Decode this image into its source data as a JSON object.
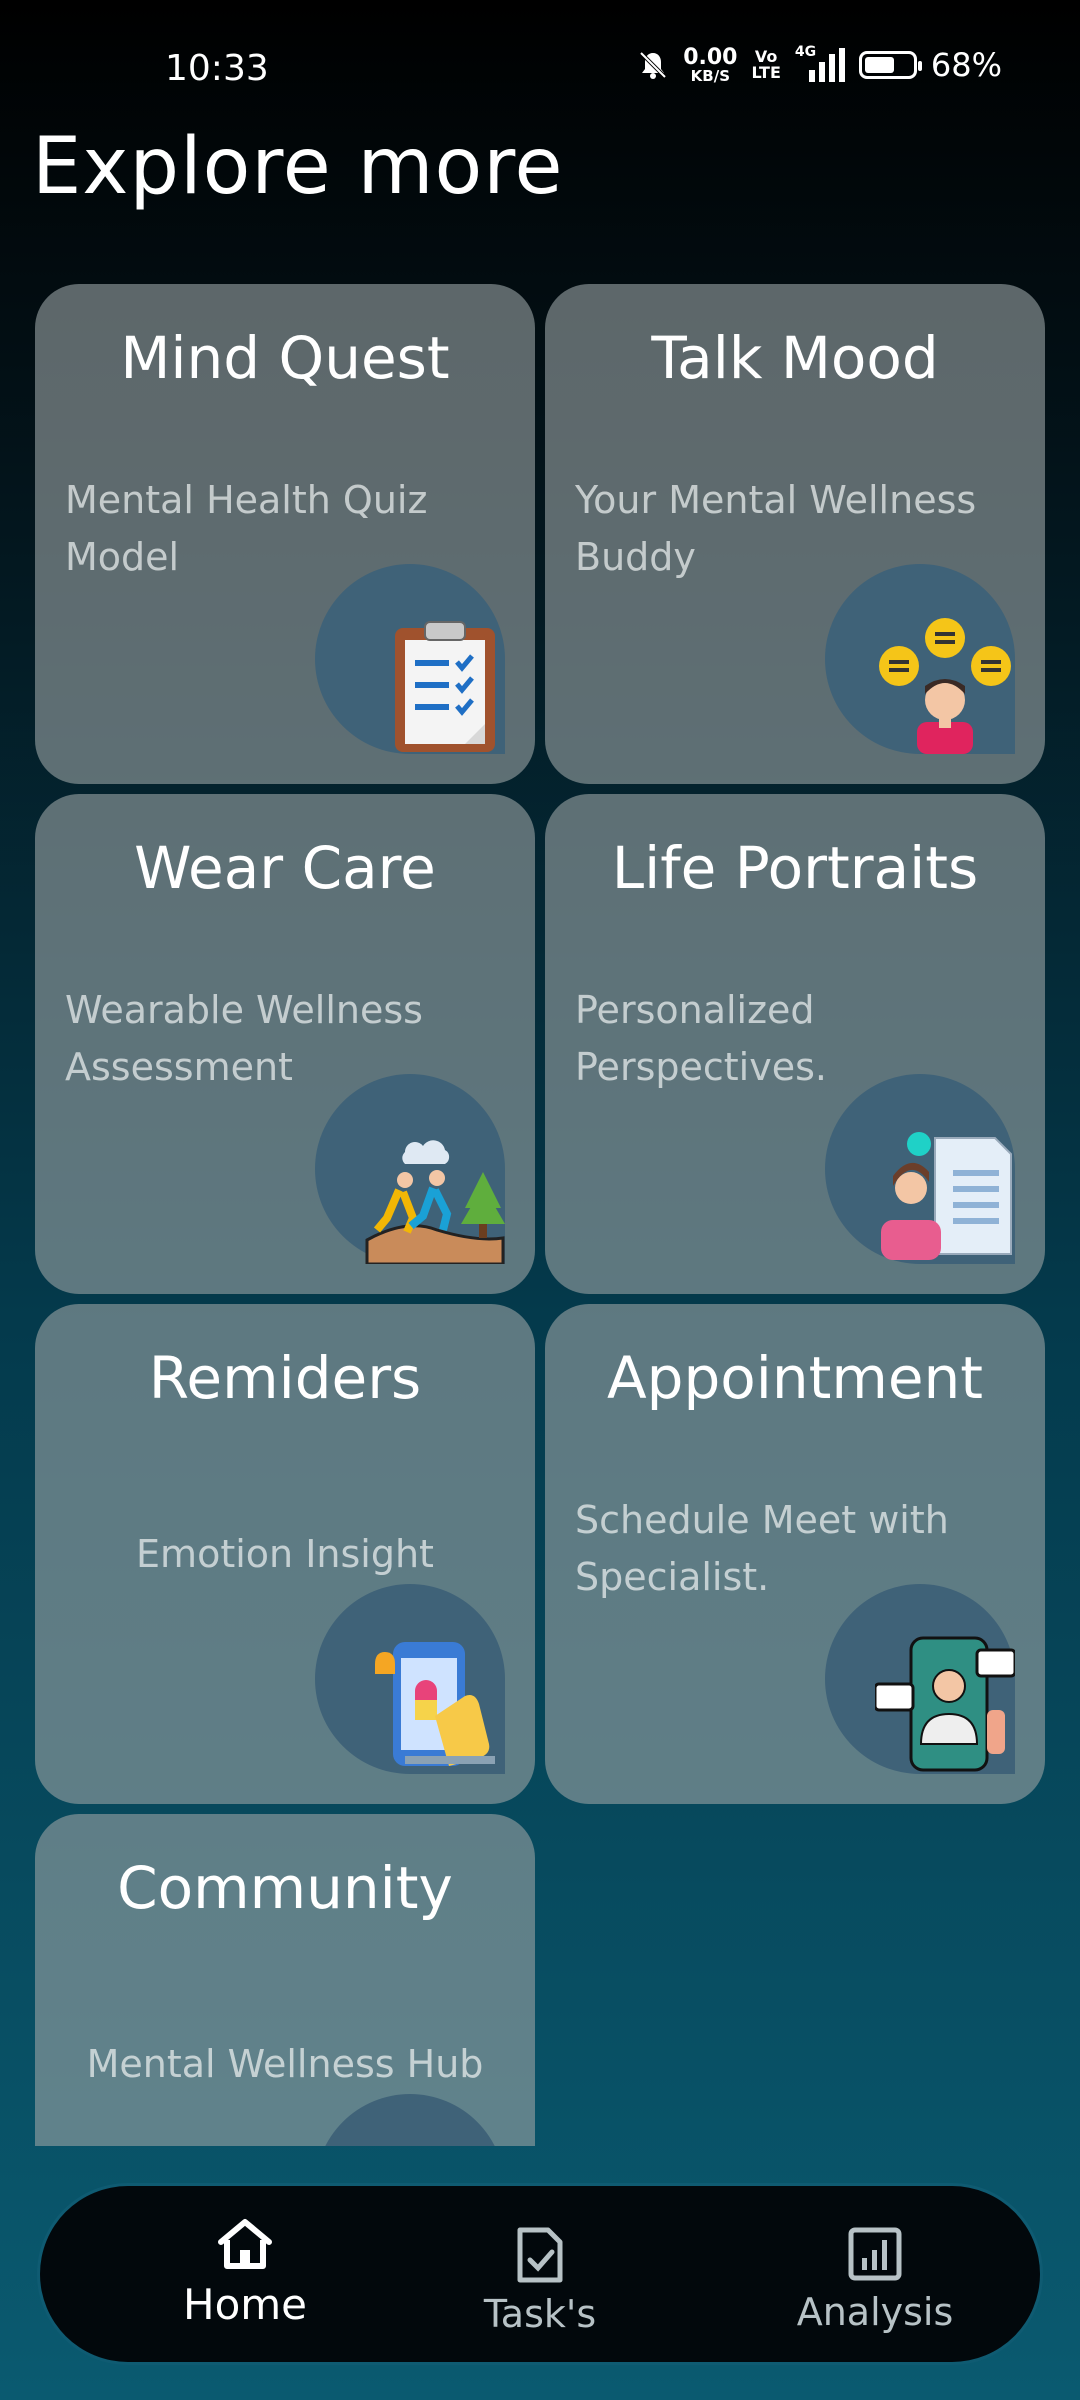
{
  "status": {
    "time": "10:33",
    "net_speed": "0.00",
    "net_unit": "KB/S",
    "volte_top": "Vo",
    "volte_bottom": "LTE",
    "signal_label": "4G",
    "battery": "68%",
    "battery_level": 0.68
  },
  "page": {
    "title": "Explore more"
  },
  "cards": [
    {
      "title": "Mind Quest",
      "subtitle": "Mental Health Quiz Model",
      "icon": "clipboard-checklist-icon"
    },
    {
      "title": "Talk Mood",
      "subtitle": "Your Mental Wellness Buddy",
      "icon": "chat-person-icon"
    },
    {
      "title": "Wear Care",
      "subtitle": "Wearable Wellness Assessment",
      "icon": "runners-icon"
    },
    {
      "title": "Life Portraits",
      "subtitle": "Personalized Perspectives.",
      "icon": "portrait-document-icon"
    },
    {
      "title": "Remiders",
      "subtitle": "Emotion Insight",
      "icon": "phone-reminder-icon"
    },
    {
      "title": "Appointment",
      "subtitle": "Schedule Meet with Specialist.",
      "icon": "doctor-video-call-icon"
    },
    {
      "title": "Community",
      "subtitle": "Mental Wellness Hub",
      "icon": "community-icon"
    }
  ],
  "nav": {
    "items": [
      {
        "label": "Home",
        "icon": "home-icon",
        "active": true
      },
      {
        "label": "Task's",
        "icon": "task-icon",
        "active": false
      },
      {
        "label": "Analysis",
        "icon": "analysis-icon",
        "active": false
      }
    ]
  },
  "colors": {
    "card_bg": "#96a0a2",
    "blob": "#3f6278",
    "nav_bg": "#02080c"
  }
}
